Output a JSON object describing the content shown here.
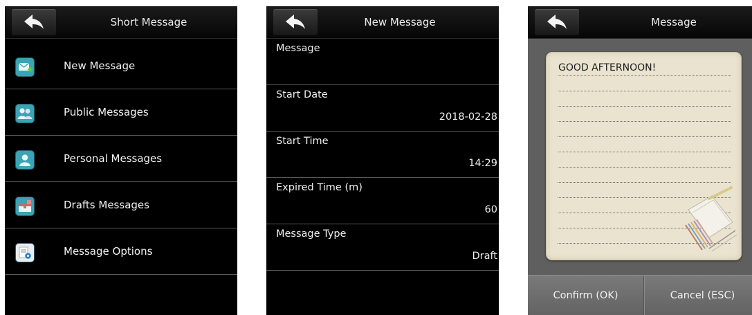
{
  "screens": [
    {
      "title": "Short Message",
      "menu": [
        {
          "label": "New Message",
          "icon": "new-message-icon"
        },
        {
          "label": "Public Messages",
          "icon": "public-messages-icon"
        },
        {
          "label": "Personal Messages",
          "icon": "personal-messages-icon"
        },
        {
          "label": "Drafts Messages",
          "icon": "drafts-messages-icon"
        },
        {
          "label": "Message Options",
          "icon": "message-options-icon"
        }
      ]
    },
    {
      "title": "New Message",
      "fields": [
        {
          "label": "Message",
          "value": ""
        },
        {
          "label": "Start Date",
          "value": "2018-02-28"
        },
        {
          "label": "Start Time",
          "value": "14:29"
        },
        {
          "label": "Expired Time (m)",
          "value": "60"
        },
        {
          "label": "Message Type",
          "value": "Draft"
        }
      ]
    },
    {
      "title": "Message",
      "note_text": "GOOD AFTERNOON!",
      "confirm_label": "Confirm (OK)",
      "cancel_label": "Cancel (ESC)"
    }
  ],
  "colors": {
    "screen_bg": "#000000",
    "message_screen_bg": "#5f5f5f",
    "note_paper": "#eae3cf",
    "icon_teal": "#3aa4b4"
  }
}
